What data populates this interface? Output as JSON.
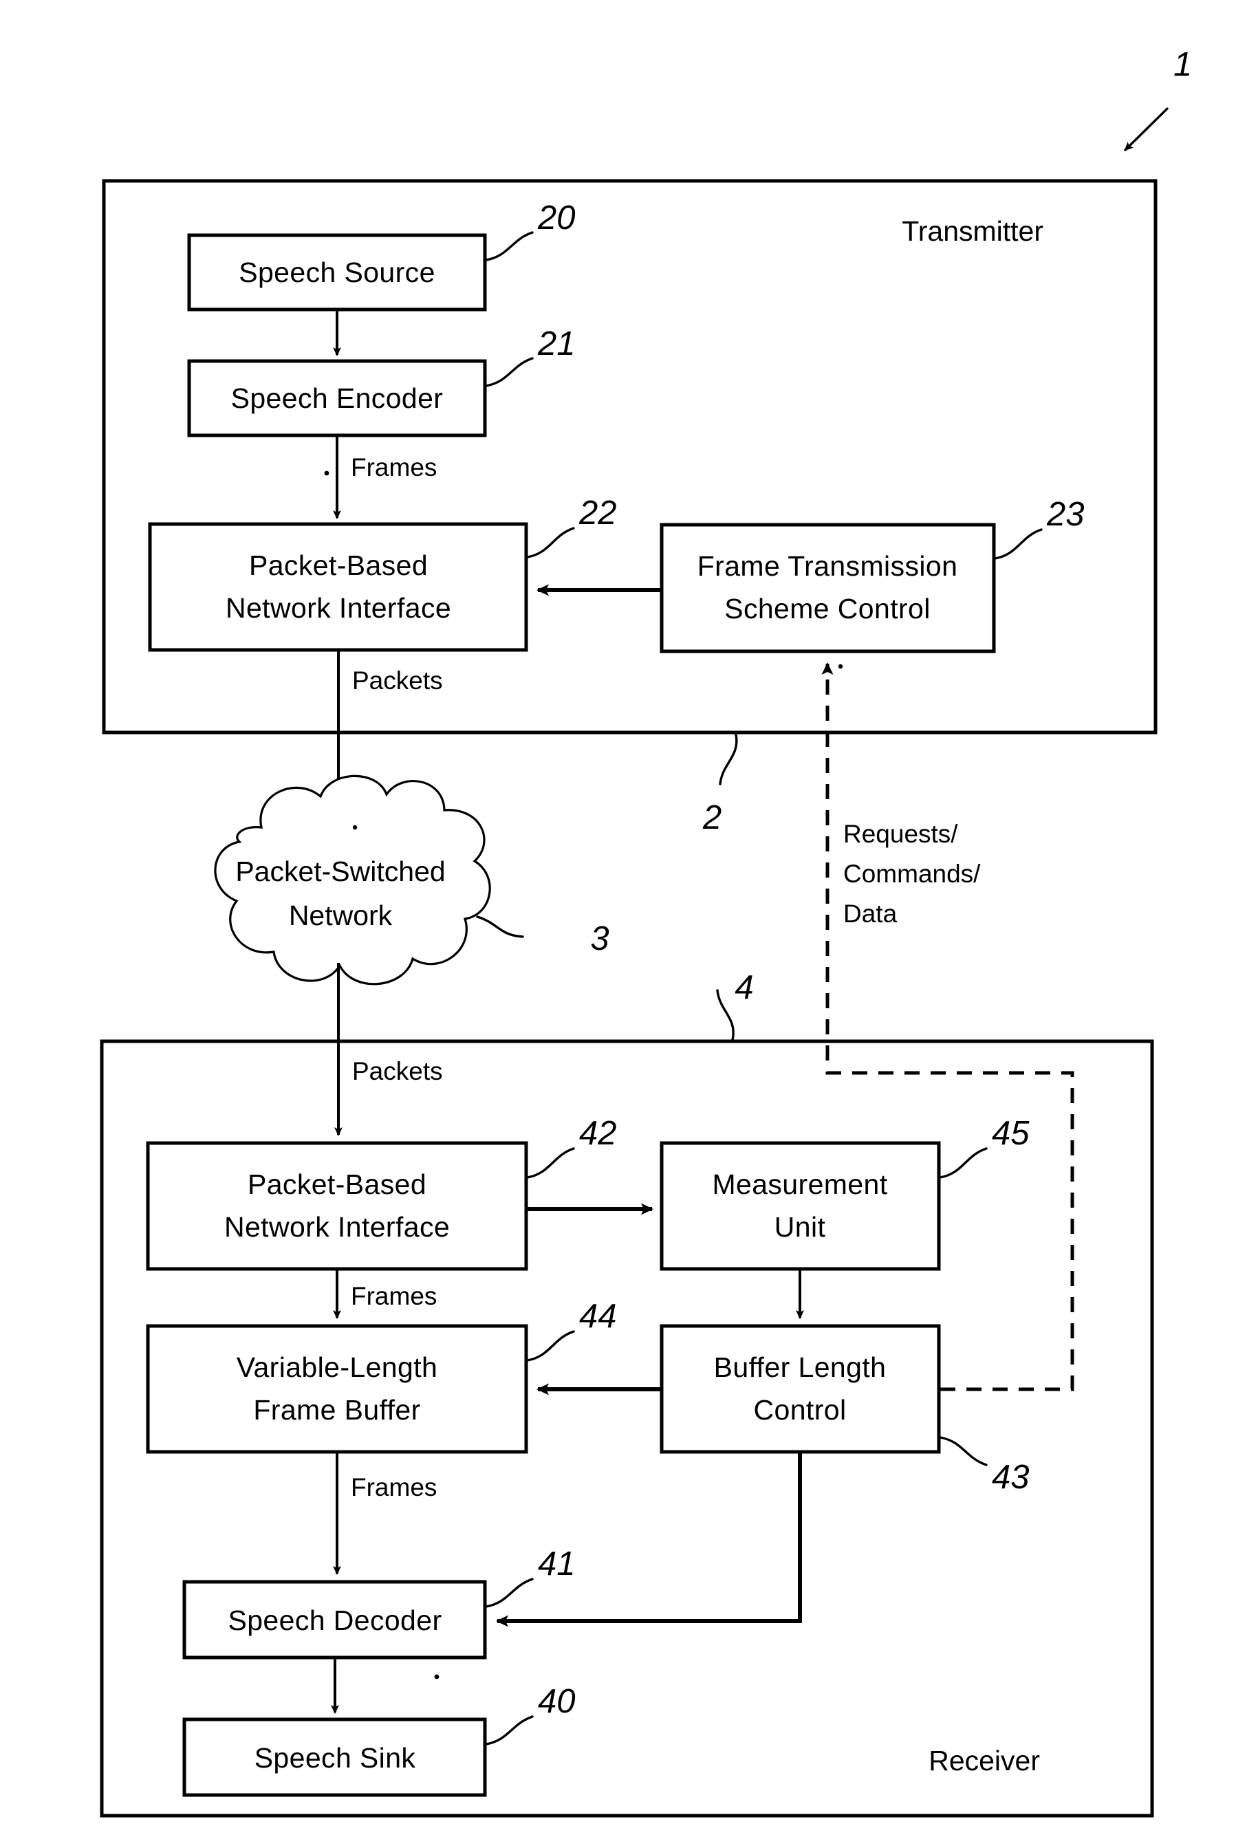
{
  "figure": {
    "overall_ref": "1",
    "transmitter": {
      "section_label": "Transmitter",
      "ref": "2",
      "blocks": [
        {
          "label": "Speech Source",
          "ref": "20"
        },
        {
          "label": "Speech Encoder",
          "ref": "21"
        },
        {
          "label_line1": "Packet-Based",
          "label_line2": "Network Interface",
          "ref": "22"
        },
        {
          "label_line1": "Frame Transmission",
          "label_line2": "Scheme Control",
          "ref": "23"
        }
      ],
      "edge_labels": {
        "encoder_to_interface": "Frames",
        "interface_to_network": "Packets"
      }
    },
    "network": {
      "label_line1": "Packet-Switched",
      "label_line2": "Network",
      "ref": "3"
    },
    "feedback": {
      "line1": "Requests/",
      "line2": "Commands/",
      "line3": "Data"
    },
    "receiver": {
      "section_label": "Receiver",
      "ref": "4",
      "blocks": [
        {
          "label_line1": "Packet-Based",
          "label_line2": "Network Interface",
          "ref": "42"
        },
        {
          "label_line1": "Measurement",
          "label_line2": "Unit",
          "ref": "45"
        },
        {
          "label_line1": "Variable-Length",
          "label_line2": "Frame Buffer",
          "ref": "44"
        },
        {
          "label_line1": "Buffer Length",
          "label_line2": "Control",
          "ref": "43"
        },
        {
          "label": "Speech Decoder",
          "ref": "41"
        },
        {
          "label": "Speech Sink",
          "ref": "40"
        }
      ],
      "edge_labels": {
        "network_to_interface": "Packets",
        "interface_to_buffer": "Frames",
        "buffer_to_decoder": "Frames"
      }
    },
    "colors": {
      "ink": "#000000",
      "paper": "#ffffff"
    }
  }
}
